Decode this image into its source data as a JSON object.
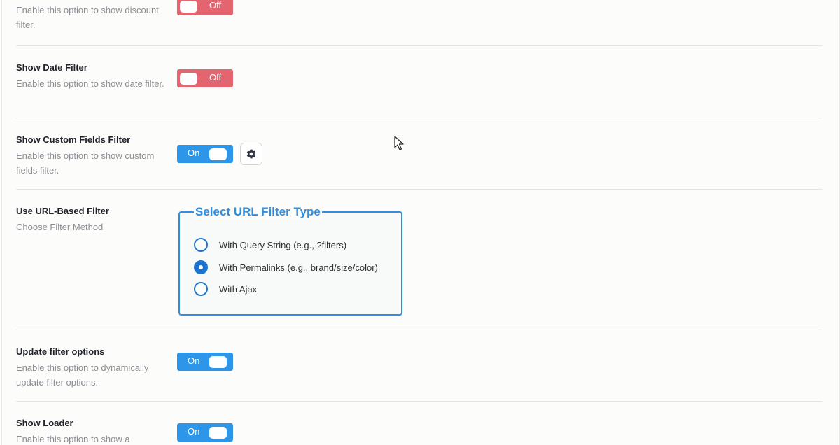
{
  "settings": {
    "discount": {
      "description": "Enable this option to show discount filter.",
      "toggle": "Off",
      "enabled": false
    },
    "date": {
      "title": "Show Date Filter",
      "description": "Enable this option to show date filter.",
      "toggle": "Off",
      "enabled": false
    },
    "custom_fields": {
      "title": "Show Custom Fields Filter",
      "description": "Enable this option to show custom fields filter.",
      "toggle": "On",
      "enabled": true,
      "settings_icon": "gear-icon"
    },
    "url_filter": {
      "title": "Use URL-Based Filter",
      "description": "Choose Filter Method",
      "group_title": "Select URL Filter Type",
      "options": [
        {
          "label": "With Query String (e.g., ?filters)",
          "selected": false
        },
        {
          "label": "With Permalinks (e.g., brand/size/color)",
          "selected": true
        },
        {
          "label": "With Ajax",
          "selected": false
        }
      ]
    },
    "update_options": {
      "title": "Update filter options",
      "description": "Enable this option to dynamically update filter options.",
      "toggle": "On",
      "enabled": true
    },
    "loader": {
      "title": "Show Loader",
      "description": "Enable this option to show a",
      "toggle": "On",
      "enabled": true
    }
  },
  "colors": {
    "toggle_off": "#e26570",
    "toggle_on": "#2e96e8",
    "accent": "#2f8ee0"
  }
}
